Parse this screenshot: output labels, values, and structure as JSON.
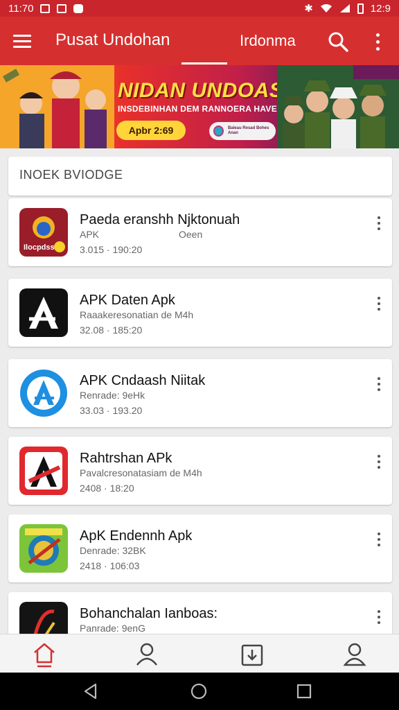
{
  "status_bar": {
    "time_left": "11:70",
    "time_right": "12:9"
  },
  "app_bar": {
    "title": "Pusat Undohan",
    "region": "Irdonma"
  },
  "banner": {
    "title": "NIDAN UNDOASI!",
    "subtitle": "INSDEBINHAN DEM RANNOERA HAVEBEN",
    "date_label": "Apbr 2:69",
    "pill_text": "Baleau Resad Bohes Anan"
  },
  "section": {
    "title": "INOEK BVIODGE"
  },
  "apps": [
    {
      "name": "Paeda eranshh Njktonuah",
      "sub": "APK",
      "extra": "Oeen",
      "meta": "3.015 · 190:20",
      "icon": "app-icon-bird"
    },
    {
      "name": "APK Daten Apk",
      "sub": "Raaakeresonatian de M4h",
      "extra": "",
      "meta": "32.08 · 185:20",
      "icon": "app-icon-a-dark"
    },
    {
      "name": "APK Cndaash Niitak",
      "sub": "Renrade: 9eHk",
      "extra": "",
      "meta": "33.03 · 193.20",
      "icon": "app-icon-a-blue"
    },
    {
      "name": "Rahtrshan APk",
      "sub": "Pavalcresonatasiam de M4h",
      "extra": "",
      "meta": "2408 · 18:20",
      "icon": "app-icon-a-red"
    },
    {
      "name": "ApK Endennh  Apk",
      "sub": "Denrade: 32BK",
      "extra": "",
      "meta": "2418 · 106:03",
      "icon": "app-icon-green"
    },
    {
      "name": "Bohanchalan Ianboas:",
      "sub": "Panrade: 9enG",
      "extra": "",
      "meta": "",
      "icon": "app-icon-dark"
    }
  ],
  "bottom_nav": [
    "home",
    "profile",
    "downloads",
    "account"
  ],
  "colors": {
    "primary": "#d62f2f",
    "status": "#c9252c",
    "accent_home": "#d62f2f"
  }
}
